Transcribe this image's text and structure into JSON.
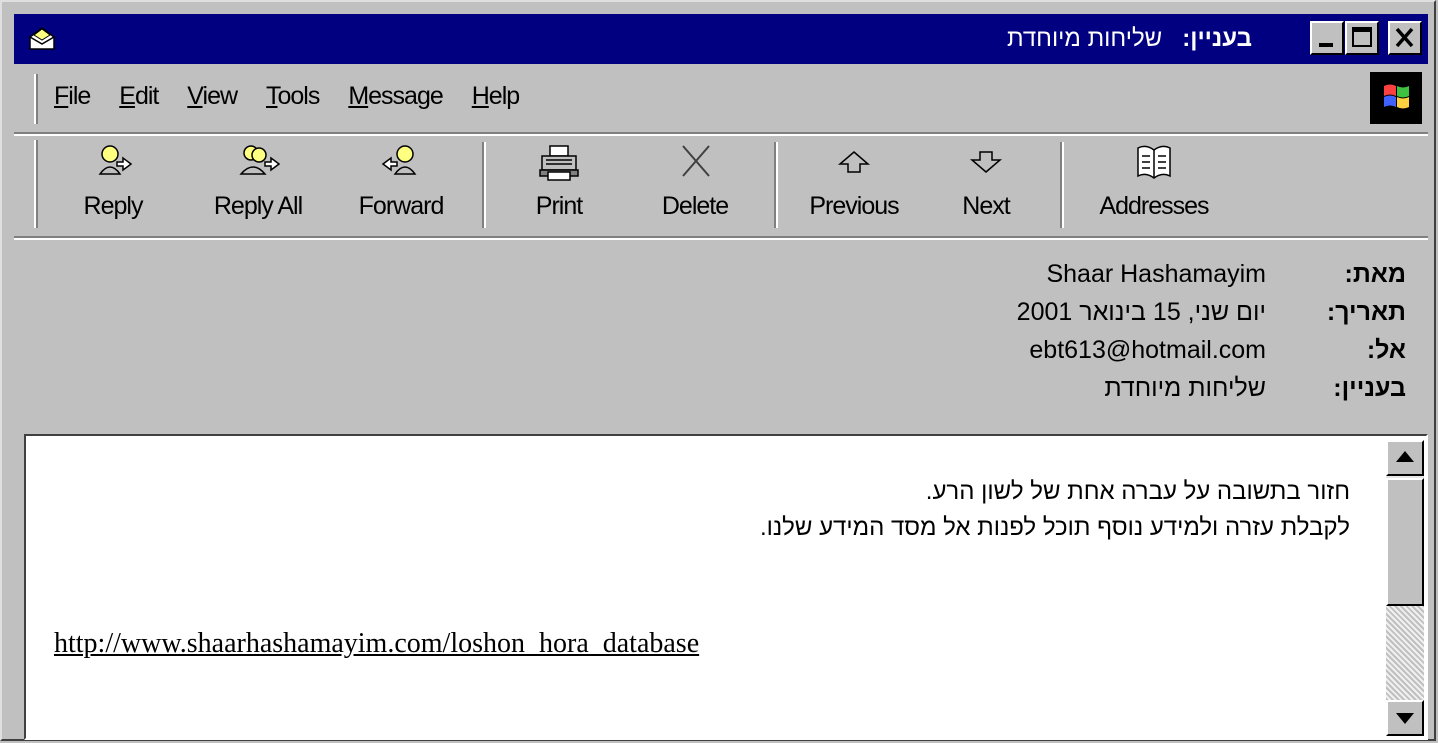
{
  "window": {
    "subject_label": "בעניין:",
    "subject_value": "שליחות מיוחדת",
    "controls": [
      "minimize",
      "maximize",
      "close"
    ]
  },
  "menu": {
    "items": [
      {
        "label": "File",
        "accel": "F",
        "rest": "ile"
      },
      {
        "label": "Edit",
        "accel": "E",
        "rest": "dit"
      },
      {
        "label": "View",
        "accel": "V",
        "rest": "iew"
      },
      {
        "label": "Tools",
        "accel": "T",
        "rest": "ools"
      },
      {
        "label": "Message",
        "accel": "M",
        "rest": "essage"
      },
      {
        "label": "Help",
        "accel": "H",
        "rest": "elp"
      }
    ]
  },
  "toolbar": {
    "reply": "Reply",
    "reply_all": "Reply All",
    "forward": "Forward",
    "print": "Print",
    "delete": "Delete",
    "previous": "Previous",
    "next": "Next",
    "addresses": "Addresses"
  },
  "headers": {
    "from_label": "מאת:",
    "from_value": "Shaar Hashamayim",
    "date_label": "תאריך:",
    "date_value": "יום שני, 15 בינואר 2001",
    "to_label": "אל:",
    "to_value": "ebt613@hotmail.com",
    "subject_label": "בעניין:",
    "subject_value": "שליחות מיוחדת"
  },
  "message": {
    "line1": "חזור בתשובה על עברה אחת של לשון הרע.",
    "line2": "לקבלת עזרה ולמידע נוסף תוכל לפנות אל מסד המידע שלנו.",
    "link": "http://www.shaarhashamayim.com/loshon_hora_database"
  }
}
